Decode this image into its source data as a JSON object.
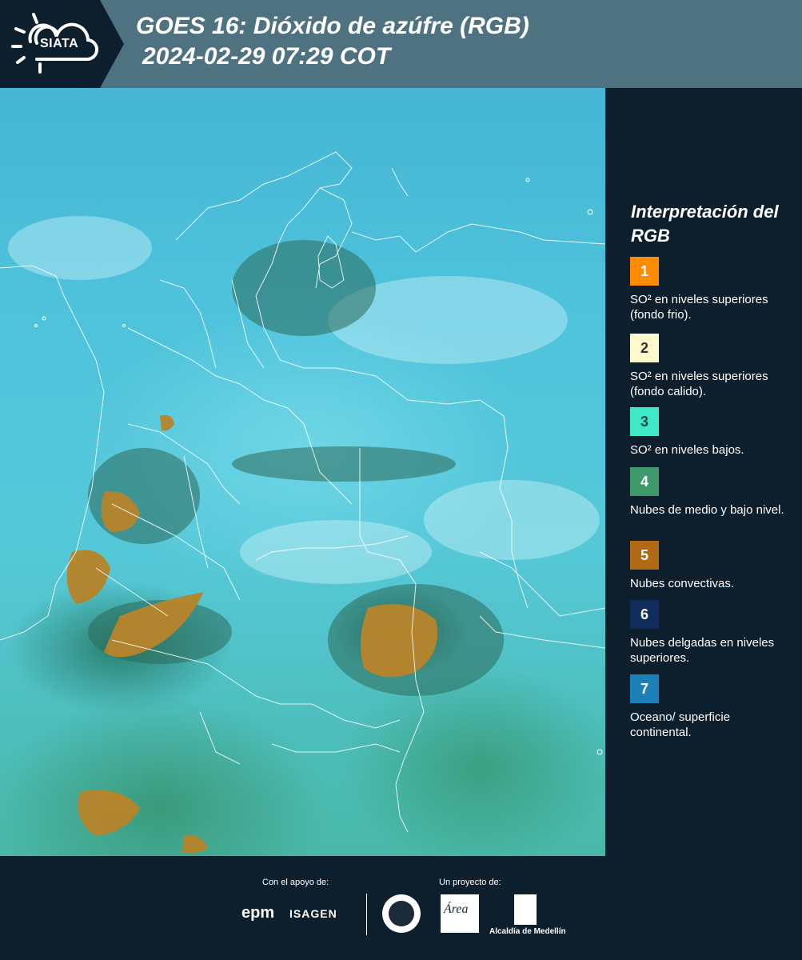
{
  "header": {
    "logo_text": "SIATA",
    "title_line1": "GOES 16: Dióxido de azúfre (RGB)",
    "title_line2": "2024-02-29 07:29 COT"
  },
  "legend": {
    "title": "Interpretación del RGB",
    "items": [
      {
        "number": "1",
        "color": "#ff8c00",
        "label": "SO² en niveles superiores (fondo frio)."
      },
      {
        "number": "2",
        "color": "#fffacd",
        "label": "SO² en niveles superiores (fondo calido)."
      },
      {
        "number": "3",
        "color": "#3ee8c8",
        "label": "SO² en niveles bajos."
      },
      {
        "number": "4",
        "color": "#3e9a6a",
        "label": "Nubes de medio y bajo nivel."
      },
      {
        "number": "5",
        "color": "#b06a14",
        "label": "Nubes convectivas."
      },
      {
        "number": "6",
        "color": "#0e2d5a",
        "label": "Nubes delgadas en niveles superiores."
      },
      {
        "number": "7",
        "color": "#1c7fb8",
        "label": "Oceano/ superficie continental."
      }
    ]
  },
  "footer": {
    "support_label": "Con el apoyo de:",
    "project_label": "Un proyecto de:",
    "sponsor1": "epm",
    "sponsor2": "ISAGEN",
    "area_text": "Área",
    "alcaldia_text": "Alcaldía de Medellín"
  },
  "colors": {
    "background": "#0d1f2d",
    "header": "#4e7280",
    "convective": "#b8842a"
  }
}
